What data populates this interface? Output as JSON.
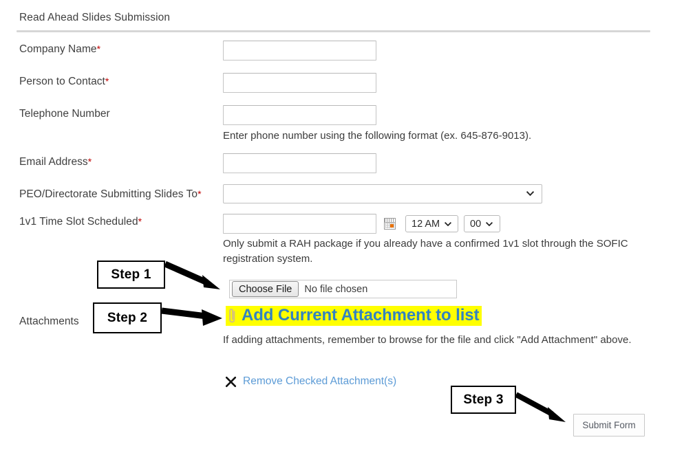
{
  "form": {
    "title": "Read Ahead Slides Submission",
    "fields": [
      {
        "label": "Company Name",
        "required_mark": "*",
        "value": "",
        "placeholder": ""
      },
      {
        "label": "Person to Contact",
        "required_mark": "*",
        "value": "",
        "placeholder": ""
      },
      {
        "label": "Telephone Number",
        "required_mark": "",
        "value": "",
        "placeholder": ""
      },
      {
        "label": "Email Address",
        "required_mark": "*",
        "value": "",
        "placeholder": ""
      },
      {
        "label": "PEO/Directorate Submitting Slides To",
        "required_mark": "*",
        "value": "",
        "placeholder": ""
      },
      {
        "label": "1v1 Time Slot Scheduled",
        "required_mark": "*",
        "value": "",
        "placeholder": ""
      },
      {
        "label": "Attachments",
        "required_mark": "",
        "value": "",
        "placeholder": ""
      }
    ],
    "phone_helper": "Enter phone number using the following format (ex. 645-876-9013).",
    "timeslot_helper": "Only submit a RAH package if you already have a confirmed 1v1 slot through the SOFIC registration system.",
    "attachment_helper": "If adding attachments, remember to browse for the file and click \"Add Attachment\" above.",
    "time": {
      "hour_value": "12 AM",
      "minute_value": "00",
      "calendar_icon": "calendar-icon"
    },
    "file": {
      "button_label": "Choose File",
      "status_text": "No file chosen"
    },
    "add_attachment": {
      "icon": "paperclip-icon",
      "label": "Add Current Attachment to list",
      "highlight_color": "#ffff00",
      "text_color": "#3383c0"
    },
    "remove_attachment": {
      "icon": "x-mark-icon",
      "label": "Remove Checked Attachment(s)",
      "text_color": "#5c9bd6"
    },
    "submit": {
      "label": "Submit Form"
    }
  },
  "annotations": {
    "steps": [
      {
        "label": "Step 1"
      },
      {
        "label": "Step 2"
      },
      {
        "label": "Step 3"
      }
    ]
  },
  "colors": {
    "required_asterisk": "#c00000",
    "label_text": "#404040",
    "link_blue": "#3383c0",
    "highlight_yellow": "#ffff00",
    "calendar_accent": "#e8730c"
  }
}
